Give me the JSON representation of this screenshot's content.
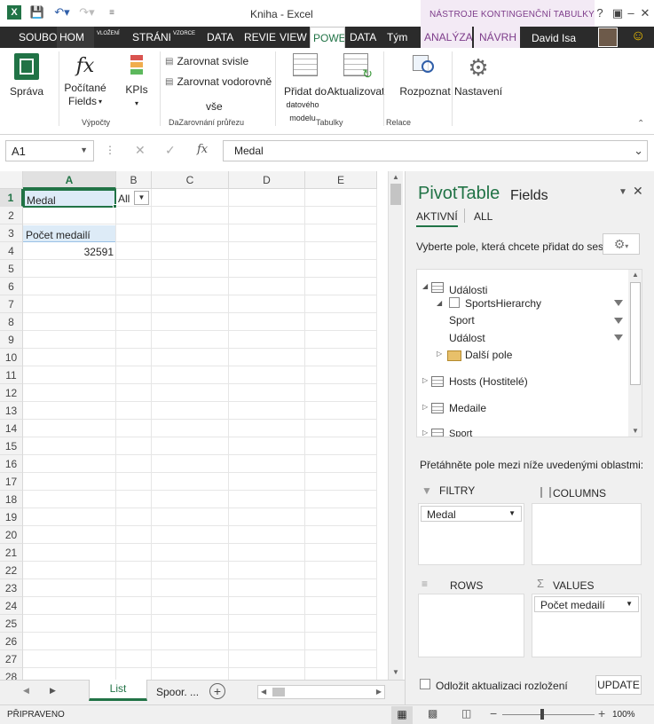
{
  "window": {
    "title": "Kniha - Excel",
    "context_group": "NÁSTROJE KONTINGENČNÍ TABULKY"
  },
  "ribbon_tabs": [
    {
      "label": "SOUBOR"
    },
    {
      "label": "HOM"
    },
    {
      "label": "VLOŽENÍ"
    },
    {
      "label": "STRÁNKA"
    },
    {
      "label": "VZORCE"
    },
    {
      "label": "DATA"
    },
    {
      "label": "REVIE"
    },
    {
      "label": "VIEW"
    },
    {
      "label": "POWE"
    },
    {
      "label": "DATA"
    },
    {
      "label": "Tým"
    },
    {
      "label": "ANALÝZA"
    },
    {
      "label": "NÁVRH"
    }
  ],
  "user": {
    "name": "David Isa"
  },
  "ribbon": {
    "manage": "Správa",
    "calc_fields_1": "Počítané",
    "calc_fields_2": "Fields",
    "kpis": "KPIs",
    "group_calc": "Výpočty",
    "align_vert": "Zarovnat svisle",
    "align_horiz": "Zarovnat vodorovně",
    "all": "vše",
    "group_align": "DaZarovnání průřezu",
    "add_to_model_1": "Přidat do",
    "add_to_model_2": "datového modelu",
    "update": "Aktualizovat",
    "group_tables": "Tabulky",
    "detect": "Rozpoznat",
    "group_rel": "Relace",
    "settings": "Nastavení"
  },
  "formula_bar": {
    "name_box": "A1",
    "formula": "Medal",
    "fx": "fx"
  },
  "grid": {
    "columns": [
      "A",
      "B",
      "C",
      "D",
      "E"
    ],
    "rows": [
      "1",
      "2",
      "3",
      "4",
      "5",
      "6",
      "7",
      "8",
      "9",
      "10",
      "11",
      "12",
      "13",
      "14",
      "15",
      "16",
      "17",
      "18",
      "19",
      "20",
      "21",
      "22",
      "23",
      "24",
      "25",
      "26",
      "27",
      "28"
    ],
    "a1": "Medal",
    "b1": "All",
    "a3": "Počet medailí",
    "a4": "32591"
  },
  "sheets": {
    "active": "List",
    "other": "Spoor. ..."
  },
  "status": {
    "ready": "PŘIPRAVENO",
    "zoom": "100%"
  },
  "pivot_pane": {
    "title_a": "PivotTable",
    "title_b": "Fields",
    "tab_active": "AKTIVNÍ",
    "tab_all": "ALL",
    "choose_fields": "Vyberte pole, která chcete přidat do sestavy:",
    "tree": {
      "events": "Události",
      "sports_hierarchy": "SportsHierarchy",
      "sport": "Sport",
      "event": "Událost",
      "more_fields": "Další pole",
      "hosts": "Hosts (Hostitelé)",
      "medals": "Medaile",
      "sport_table": "Sport"
    },
    "drag_hint": "Přetáhněte pole mezi níže uvedenými oblastmi:",
    "filters": "FILTRY",
    "columns": "COLUMNS",
    "rows": "ROWS",
    "values": "VALUES",
    "filter_item": "Medal",
    "value_item": "Počet medailí",
    "defer": "Odložit aktualizaci rozložení",
    "update_btn": "UPDATE"
  }
}
